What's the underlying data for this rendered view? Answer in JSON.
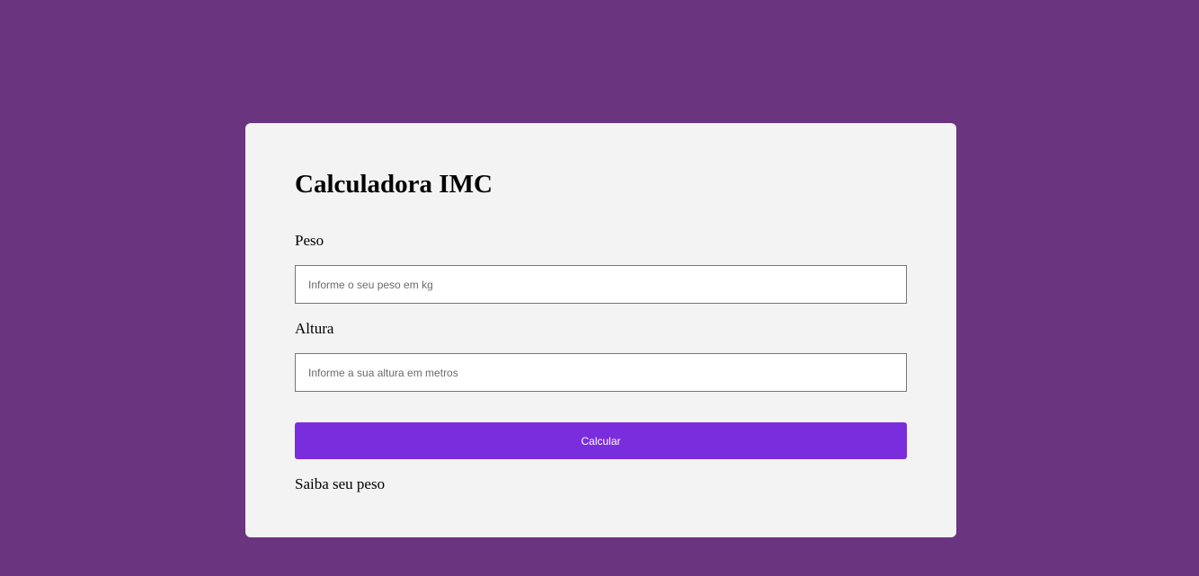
{
  "colors": {
    "page_background": "#6a347f",
    "card_background": "#f3f3f3",
    "button_accent": "#7a2ddc"
  },
  "form": {
    "title": "Calculadora IMC",
    "peso": {
      "label": "Peso",
      "value": "",
      "placeholder": "Informe o seu peso em kg"
    },
    "altura": {
      "label": "Altura",
      "value": "",
      "placeholder": "Informe a sua altura em metros"
    },
    "submit_label": "Calcular",
    "result_text": "Saiba seu peso"
  }
}
